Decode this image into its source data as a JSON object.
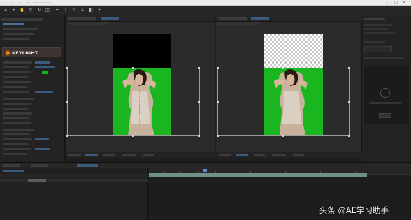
{
  "app": {
    "title_text": "· · · · · · · · · · · · · · · · · · · · · · · · · · ·"
  },
  "effect_panel": {
    "effect_name": "KEYLIGHT",
    "screen_colour_swatch": "#17b51b"
  },
  "watermark": {
    "text": "头条 @AE学习助手"
  },
  "colors": {
    "ui_background": "#1e1e1e",
    "panel": "#232323",
    "green_screen": "#19b61f",
    "keylight_accent": "#e07a18",
    "accent_blue": "#5d8ec9",
    "playhead": "#cc3333",
    "layer_bar": "#6f8f8a"
  },
  "icons": [
    "home-icon",
    "arrow-tool-icon",
    "hand-tool-icon",
    "zoom-tool-icon",
    "rotate-tool-icon",
    "camera-tool-icon",
    "pen-tool-icon",
    "text-tool-icon",
    "brush-tool-icon",
    "stamp-tool-icon",
    "eraser-tool-icon",
    "puppet-tool-icon",
    "keylight-logo-icon"
  ]
}
